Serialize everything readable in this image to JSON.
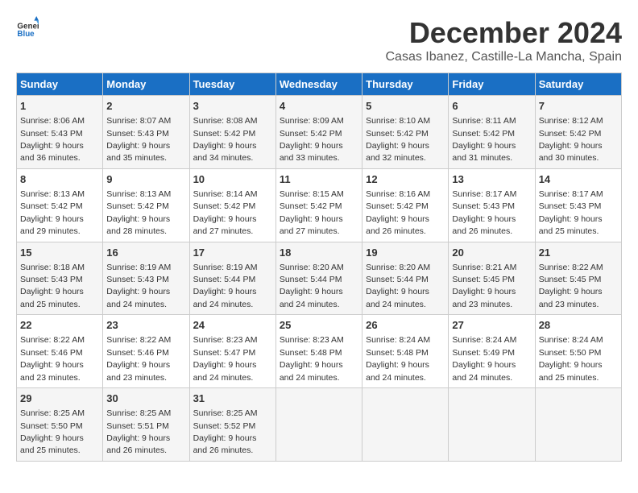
{
  "logo": {
    "general": "General",
    "blue": "Blue"
  },
  "title": "December 2024",
  "subtitle": "Casas Ibanez, Castille-La Mancha, Spain",
  "days_header": [
    "Sunday",
    "Monday",
    "Tuesday",
    "Wednesday",
    "Thursday",
    "Friday",
    "Saturday"
  ],
  "weeks": [
    [
      {
        "day": "1",
        "info": "Sunrise: 8:06 AM\nSunset: 5:43 PM\nDaylight: 9 hours\nand 36 minutes."
      },
      {
        "day": "2",
        "info": "Sunrise: 8:07 AM\nSunset: 5:43 PM\nDaylight: 9 hours\nand 35 minutes."
      },
      {
        "day": "3",
        "info": "Sunrise: 8:08 AM\nSunset: 5:42 PM\nDaylight: 9 hours\nand 34 minutes."
      },
      {
        "day": "4",
        "info": "Sunrise: 8:09 AM\nSunset: 5:42 PM\nDaylight: 9 hours\nand 33 minutes."
      },
      {
        "day": "5",
        "info": "Sunrise: 8:10 AM\nSunset: 5:42 PM\nDaylight: 9 hours\nand 32 minutes."
      },
      {
        "day": "6",
        "info": "Sunrise: 8:11 AM\nSunset: 5:42 PM\nDaylight: 9 hours\nand 31 minutes."
      },
      {
        "day": "7",
        "info": "Sunrise: 8:12 AM\nSunset: 5:42 PM\nDaylight: 9 hours\nand 30 minutes."
      }
    ],
    [
      {
        "day": "8",
        "info": "Sunrise: 8:13 AM\nSunset: 5:42 PM\nDaylight: 9 hours\nand 29 minutes."
      },
      {
        "day": "9",
        "info": "Sunrise: 8:13 AM\nSunset: 5:42 PM\nDaylight: 9 hours\nand 28 minutes."
      },
      {
        "day": "10",
        "info": "Sunrise: 8:14 AM\nSunset: 5:42 PM\nDaylight: 9 hours\nand 27 minutes."
      },
      {
        "day": "11",
        "info": "Sunrise: 8:15 AM\nSunset: 5:42 PM\nDaylight: 9 hours\nand 27 minutes."
      },
      {
        "day": "12",
        "info": "Sunrise: 8:16 AM\nSunset: 5:42 PM\nDaylight: 9 hours\nand 26 minutes."
      },
      {
        "day": "13",
        "info": "Sunrise: 8:17 AM\nSunset: 5:43 PM\nDaylight: 9 hours\nand 26 minutes."
      },
      {
        "day": "14",
        "info": "Sunrise: 8:17 AM\nSunset: 5:43 PM\nDaylight: 9 hours\nand 25 minutes."
      }
    ],
    [
      {
        "day": "15",
        "info": "Sunrise: 8:18 AM\nSunset: 5:43 PM\nDaylight: 9 hours\nand 25 minutes."
      },
      {
        "day": "16",
        "info": "Sunrise: 8:19 AM\nSunset: 5:43 PM\nDaylight: 9 hours\nand 24 minutes."
      },
      {
        "day": "17",
        "info": "Sunrise: 8:19 AM\nSunset: 5:44 PM\nDaylight: 9 hours\nand 24 minutes."
      },
      {
        "day": "18",
        "info": "Sunrise: 8:20 AM\nSunset: 5:44 PM\nDaylight: 9 hours\nand 24 minutes."
      },
      {
        "day": "19",
        "info": "Sunrise: 8:20 AM\nSunset: 5:44 PM\nDaylight: 9 hours\nand 24 minutes."
      },
      {
        "day": "20",
        "info": "Sunrise: 8:21 AM\nSunset: 5:45 PM\nDaylight: 9 hours\nand 23 minutes."
      },
      {
        "day": "21",
        "info": "Sunrise: 8:22 AM\nSunset: 5:45 PM\nDaylight: 9 hours\nand 23 minutes."
      }
    ],
    [
      {
        "day": "22",
        "info": "Sunrise: 8:22 AM\nSunset: 5:46 PM\nDaylight: 9 hours\nand 23 minutes."
      },
      {
        "day": "23",
        "info": "Sunrise: 8:22 AM\nSunset: 5:46 PM\nDaylight: 9 hours\nand 23 minutes."
      },
      {
        "day": "24",
        "info": "Sunrise: 8:23 AM\nSunset: 5:47 PM\nDaylight: 9 hours\nand 24 minutes."
      },
      {
        "day": "25",
        "info": "Sunrise: 8:23 AM\nSunset: 5:48 PM\nDaylight: 9 hours\nand 24 minutes."
      },
      {
        "day": "26",
        "info": "Sunrise: 8:24 AM\nSunset: 5:48 PM\nDaylight: 9 hours\nand 24 minutes."
      },
      {
        "day": "27",
        "info": "Sunrise: 8:24 AM\nSunset: 5:49 PM\nDaylight: 9 hours\nand 24 minutes."
      },
      {
        "day": "28",
        "info": "Sunrise: 8:24 AM\nSunset: 5:50 PM\nDaylight: 9 hours\nand 25 minutes."
      }
    ],
    [
      {
        "day": "29",
        "info": "Sunrise: 8:25 AM\nSunset: 5:50 PM\nDaylight: 9 hours\nand 25 minutes."
      },
      {
        "day": "30",
        "info": "Sunrise: 8:25 AM\nSunset: 5:51 PM\nDaylight: 9 hours\nand 26 minutes."
      },
      {
        "day": "31",
        "info": "Sunrise: 8:25 AM\nSunset: 5:52 PM\nDaylight: 9 hours\nand 26 minutes."
      },
      null,
      null,
      null,
      null
    ]
  ]
}
